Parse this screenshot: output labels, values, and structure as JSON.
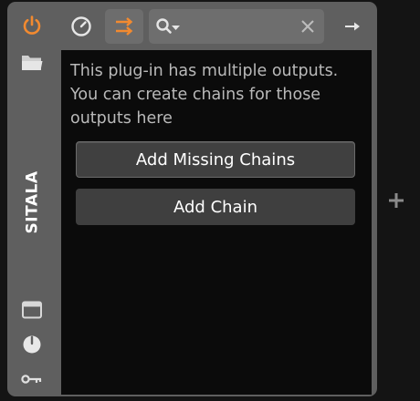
{
  "device": {
    "name": "SITALA",
    "accent_color": "#f28a30",
    "left_strip": {
      "icons": [
        {
          "name": "power-icon",
          "state": "on"
        },
        {
          "name": "folder-icon"
        },
        {
          "name": "window-icon"
        },
        {
          "name": "knob-icon"
        },
        {
          "name": "key-icon"
        }
      ]
    },
    "toolbar": {
      "icons": [
        {
          "name": "dial-icon"
        },
        {
          "name": "outputs-routing-icon",
          "state": "active"
        },
        {
          "name": "search-icon"
        },
        {
          "name": "clear-icon"
        },
        {
          "name": "arrow-right-icon"
        }
      ],
      "search": {
        "value": "",
        "placeholder": ""
      }
    }
  },
  "panel": {
    "message": "This plug-in has multiple outputs. You can create chains for those outputs here",
    "buttons": {
      "add_missing_chains": "Add Missing Chains",
      "add_chain": "Add Chain"
    }
  },
  "side": {
    "plus_icon": "plus-icon"
  }
}
